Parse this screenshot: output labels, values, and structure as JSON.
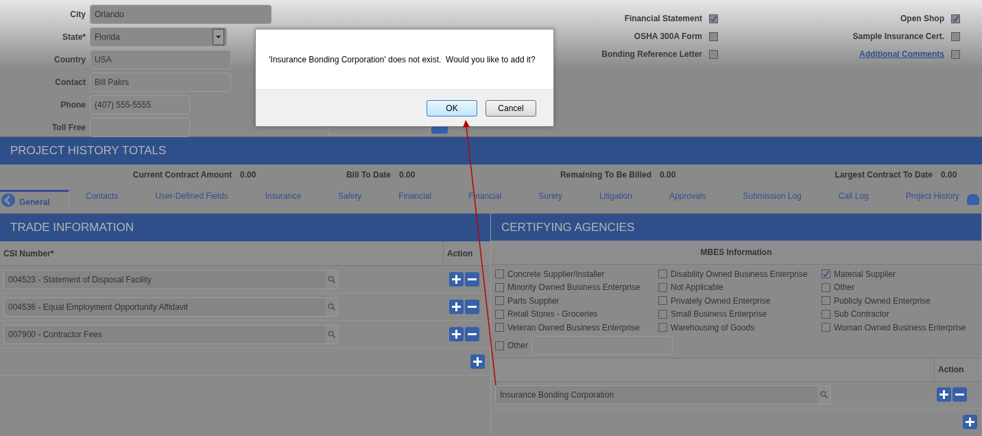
{
  "contact_form": [
    {
      "label": "City",
      "value": "Orlando",
      "kind": "text"
    },
    {
      "label": "State*",
      "value": "Florida",
      "kind": "select"
    },
    {
      "label": "Country",
      "value": "USA",
      "kind": "text"
    },
    {
      "label": "Contact",
      "value": "Bill Pakrs",
      "kind": "text"
    },
    {
      "label": "Phone",
      "value": "(407) 555-5555",
      "kind": "text"
    },
    {
      "label": "Toll Free",
      "kind": "text"
    }
  ],
  "document_checklist": [
    {
      "label": "Financial Statement",
      "checked": true,
      "kind": "plain"
    },
    {
      "label": "Open Shop",
      "checked": true,
      "kind": "plain"
    },
    {
      "label": "OSHA 300A Form",
      "checked": false,
      "kind": "plain"
    },
    {
      "label": "Sample Insurance Cert.",
      "checked": false,
      "kind": "plain"
    },
    {
      "label": "Bonding Reference Letter",
      "checked": false,
      "kind": "plain"
    },
    {
      "label": "Additional Comments",
      "checked": false,
      "kind": "link"
    }
  ],
  "project_history_totals": {
    "title": "PROJECT HISTORY TOTALS",
    "items": [
      {
        "label": "Current Contract Amount",
        "value": "0.00"
      },
      {
        "label": "Bill To Date",
        "value": "0.00"
      },
      {
        "label": "Remaining To Be Billed",
        "value": "0.00"
      },
      {
        "label": "Largest Contract To Date",
        "value": "0.00"
      }
    ]
  },
  "tabs": [
    {
      "label": "General",
      "selected": true
    },
    {
      "label": "Contacts",
      "selected": false
    },
    {
      "label": "User-Defined Fields",
      "selected": false
    },
    {
      "label": "Insurance",
      "selected": false
    },
    {
      "label": "Safety",
      "selected": false
    },
    {
      "label": "Financial",
      "selected": false
    },
    {
      "label": "Financial",
      "selected": false
    },
    {
      "label": "Surety",
      "selected": false
    },
    {
      "label": "Litigation",
      "selected": false
    },
    {
      "label": "Approvals",
      "selected": false
    },
    {
      "label": "Submission Log",
      "selected": false
    },
    {
      "label": "Call Log",
      "selected": false
    },
    {
      "label": "Project History",
      "selected": false
    }
  ],
  "trade_information": {
    "title": "TRADE INFORMATION",
    "columns": [
      "CSI Number*",
      "Action"
    ],
    "rows": [
      {
        "value": "004523 - Statement of Disposal Facility"
      },
      {
        "value": "004536 - Equal Employment Opportunity Affidavit"
      },
      {
        "value": "007900 - Contractor Fees"
      }
    ]
  },
  "certifying_agencies": {
    "title": "CERTIFYING AGENCIES",
    "mbes_title": "MBES Information",
    "options": [
      {
        "label": "Concrete Supplier/Installer",
        "checked": false
      },
      {
        "label": "Disability Owned Business Enterprise",
        "checked": false
      },
      {
        "label": "Material Supplier",
        "checked": true
      },
      {
        "label": "Minority Owned Business Enterprise",
        "checked": false
      },
      {
        "label": "Not Applicable",
        "checked": false
      },
      {
        "label": "Other",
        "checked": false
      },
      {
        "label": "Parts Supplier",
        "checked": false
      },
      {
        "label": "Privately Owned Enterprise",
        "checked": false
      },
      {
        "label": "Publicly Owned Enterprise",
        "checked": false
      },
      {
        "label": "Retail Stores - Groceries",
        "checked": false
      },
      {
        "label": "Small Business Enterprise",
        "checked": false
      },
      {
        "label": "Sub Contractor",
        "checked": false
      },
      {
        "label": "Veteran Owned Business Enterprise",
        "checked": false
      },
      {
        "label": "Warehousing of Goods",
        "checked": false
      },
      {
        "label": "Woman Owned Business Enterprise",
        "checked": false
      }
    ],
    "other_option": {
      "label": "Other",
      "checked": false
    },
    "action_column": "Action",
    "agencies": [
      {
        "value": "Insurance Bonding Corporation"
      }
    ]
  },
  "dialog": {
    "message": "'Insurance Bonding Corporation' does not exist.  Would you like to add it?",
    "buttons": [
      {
        "label": "OK",
        "default": true
      },
      {
        "label": "Cancel",
        "default": false
      }
    ]
  }
}
